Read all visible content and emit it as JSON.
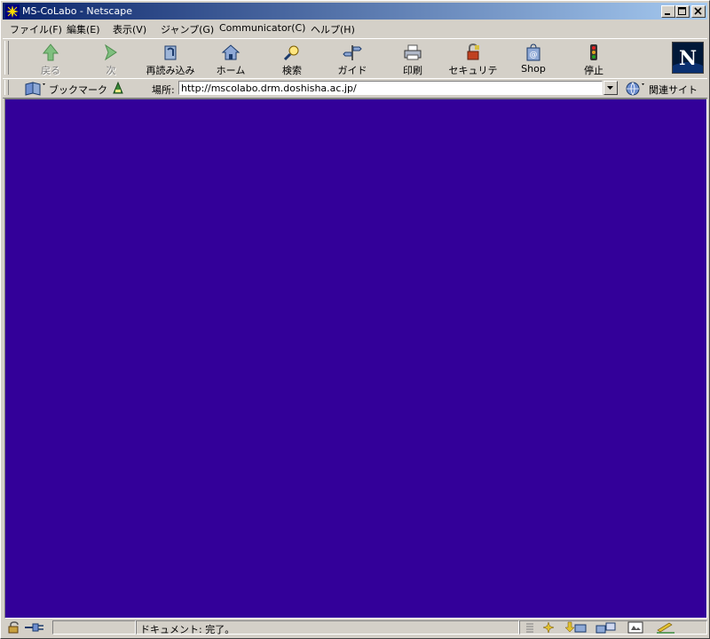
{
  "window": {
    "title": "MS-CoLabo - Netscape",
    "icon": "netscape-app-icon"
  },
  "menu": {
    "items": [
      "ファイル(F)",
      "編集(E)",
      "表示(V)",
      "ジャンプ(G)",
      "Communicator(C)",
      "ヘルプ(H)"
    ]
  },
  "toolbar": {
    "back": "戻る",
    "forward": "次",
    "reload": "再読み込み",
    "home": "ホーム",
    "search": "検索",
    "guide": "ガイド",
    "print": "印刷",
    "security": "セキュリティ",
    "shop": "Shop",
    "stop": "停止"
  },
  "location": {
    "bookmarks_label": "ブックマーク",
    "label": "場所:",
    "url": "http://mscolabo.drm.doshisha.ac.jp/",
    "related_label": "関連サイト"
  },
  "content": {
    "background": "#330099"
  },
  "status": {
    "text": "ドキュメント: 完了。"
  },
  "colors": {
    "titlebar_start": "#0a246a",
    "titlebar_end": "#a6caf0",
    "chrome": "#d4d0c8",
    "page_background": "#330099"
  }
}
